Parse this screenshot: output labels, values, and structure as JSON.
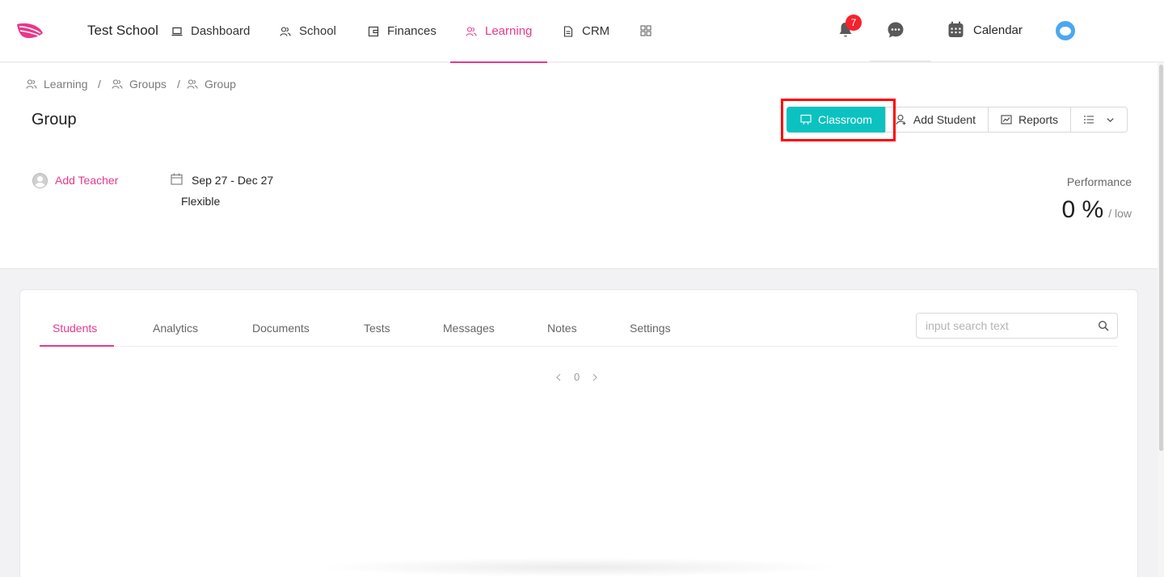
{
  "app": {
    "school_name": "Test School",
    "brand_color": "#e8388a",
    "accent_color": "#0bc2c0"
  },
  "nav": {
    "items": [
      {
        "label": "Dashboard",
        "icon": "laptop-icon"
      },
      {
        "label": "School",
        "icon": "users-icon"
      },
      {
        "label": "Finances",
        "icon": "wallet-icon"
      },
      {
        "label": "Learning",
        "icon": "users-icon",
        "active": true
      },
      {
        "label": "CRM",
        "icon": "document-icon"
      }
    ],
    "notifications_count": "7",
    "calendar_label": "Calendar"
  },
  "breadcrumb": [
    "Learning",
    "Groups",
    "Group"
  ],
  "page": {
    "title": "Group"
  },
  "actions": {
    "classroom": "Classroom",
    "add_student": "Add Student",
    "reports": "Reports"
  },
  "group_info": {
    "add_teacher": "Add Teacher",
    "date_range": "Sep 27 - Dec 27",
    "schedule": "Flexible",
    "performance_label": "Performance",
    "performance_value": "0 %",
    "performance_level": "/ low"
  },
  "tabs": [
    "Students",
    "Analytics",
    "Documents",
    "Tests",
    "Messages",
    "Notes",
    "Settings"
  ],
  "search": {
    "placeholder": "input search text",
    "value": ""
  },
  "pagination": {
    "current": "0"
  }
}
